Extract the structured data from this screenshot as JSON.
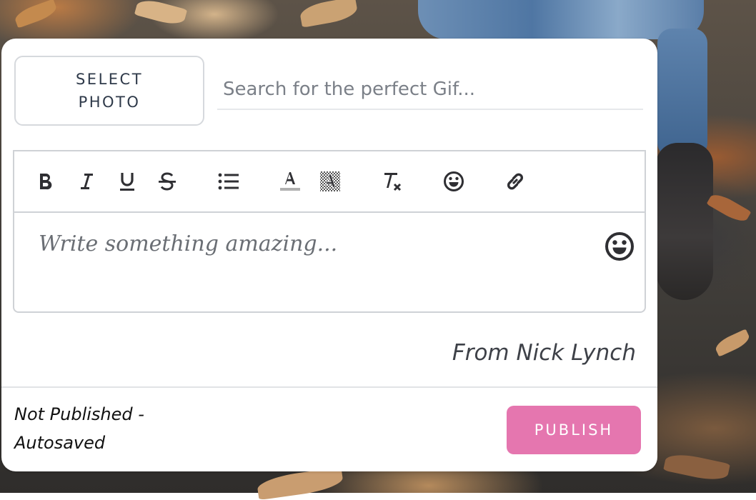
{
  "composer": {
    "select_photo_label": "SELECT PHOTO",
    "gif_search_placeholder": "Search for the perfect Gif...",
    "editor_placeholder": "Write something amazing...",
    "from_line": "From Nick Lynch",
    "status_text": "Not Published - Autosaved",
    "publish_label": "PUBLISH"
  },
  "toolbar": {
    "tools": [
      "bold-icon",
      "italic-icon",
      "underline-icon",
      "strikethrough-icon",
      "bullet-list-icon",
      "text-color-icon",
      "highlight-color-icon",
      "clear-formatting-icon",
      "emoji-icon",
      "link-icon"
    ]
  },
  "colors": {
    "publish_button": "#e576af",
    "card_background": "#ffffff",
    "border": "#cfd2d6"
  }
}
